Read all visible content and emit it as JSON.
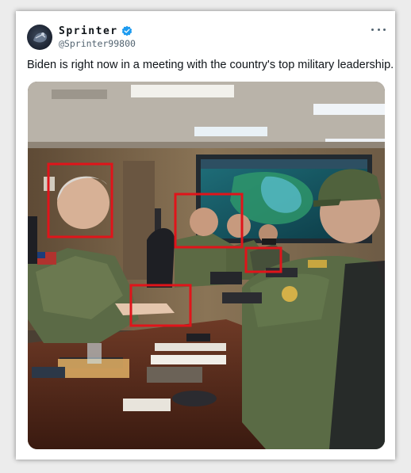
{
  "tweet": {
    "display_name": "Sprinter",
    "handle": "@Sprinter99800",
    "text": "Biden is right now in a meeting with the country's top military leadership.",
    "verified_color": "#1d9bf0",
    "more_icon": "ellipsis-icon"
  },
  "media": {
    "kind": "photo",
    "highlight_color": "#e0141a",
    "highlight_box_count": 4
  }
}
